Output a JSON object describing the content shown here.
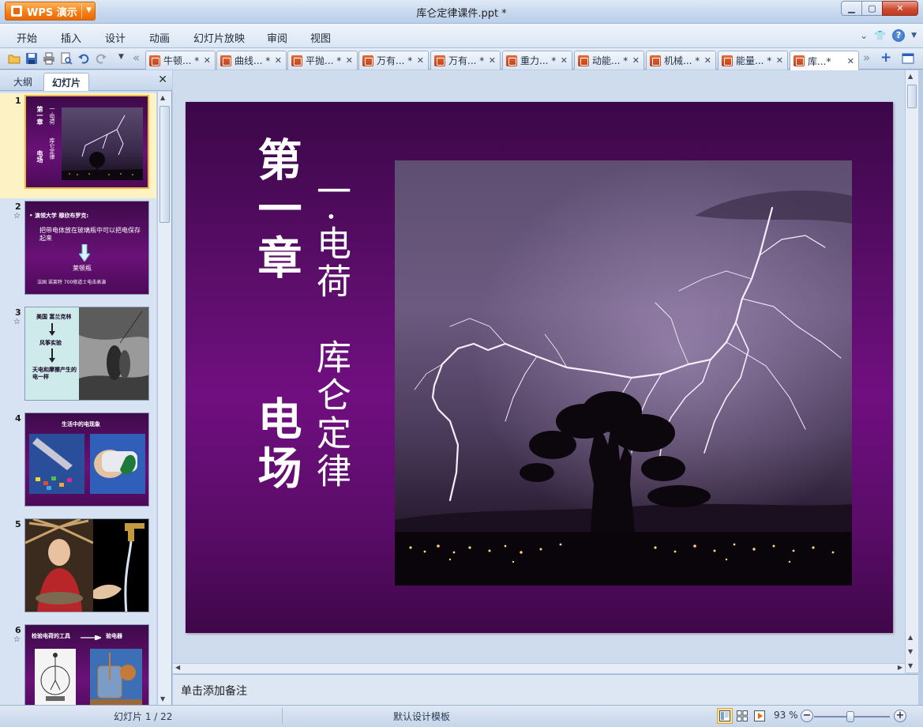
{
  "app": {
    "brand_label": "WPS 演示",
    "document_title": "库仑定律课件.ppt *"
  },
  "menu": {
    "items": [
      "开始",
      "插入",
      "设计",
      "动画",
      "幻灯片放映",
      "审阅",
      "视图"
    ]
  },
  "tabs": [
    {
      "label": "牛顿... *"
    },
    {
      "label": "曲线... *"
    },
    {
      "label": "平抛... *"
    },
    {
      "label": "万有... *"
    },
    {
      "label": "万有... *"
    },
    {
      "label": "重力... *"
    },
    {
      "label": "动能... *"
    },
    {
      "label": "机械... *"
    },
    {
      "label": "能量... *"
    },
    {
      "label": "库...*",
      "active": true
    }
  ],
  "left_panel": {
    "tabs": [
      "大纲",
      "幻灯片"
    ],
    "active_tab": "幻灯片",
    "thumbnails": [
      {
        "number": "1",
        "star": ""
      },
      {
        "number": "2",
        "star": "☆"
      },
      {
        "number": "3",
        "star": "☆"
      },
      {
        "number": "4",
        "star": ""
      },
      {
        "number": "5",
        "star": ""
      },
      {
        "number": "6",
        "star": "☆"
      }
    ],
    "thumb_text": {
      "t2_line1": "• 演领大学 穆欣布罗克:",
      "t2_line2": "把带电体放在玻璃瓶中可以把电保存起来",
      "t2_line3": "莱顿瓶",
      "t2_line4": "法国 诺莱特     700修道士电击表演",
      "t3_line1": "美国 富兰克林",
      "t3_line2": "风筝实验",
      "t3_line3": "天电和摩擦产生的电一样",
      "t4_title": "生活中的电现象",
      "t6_title": "检验电荷的工具",
      "t6_right": "验电器"
    }
  },
  "slide": {
    "title_col1": "第一章",
    "title_col2": "电场",
    "subtitle_col1": "一·电荷",
    "subtitle_col2": "库仑定律"
  },
  "notes": {
    "placeholder": "单击添加备注"
  },
  "status": {
    "slide_counter": "幻灯片 1 / 22",
    "template": "默认设计模板",
    "zoom": "93 %"
  },
  "colors": {
    "slide_bg": "#6a1178",
    "accent_orange": "#f57d12",
    "selection": "#f0b73a"
  }
}
